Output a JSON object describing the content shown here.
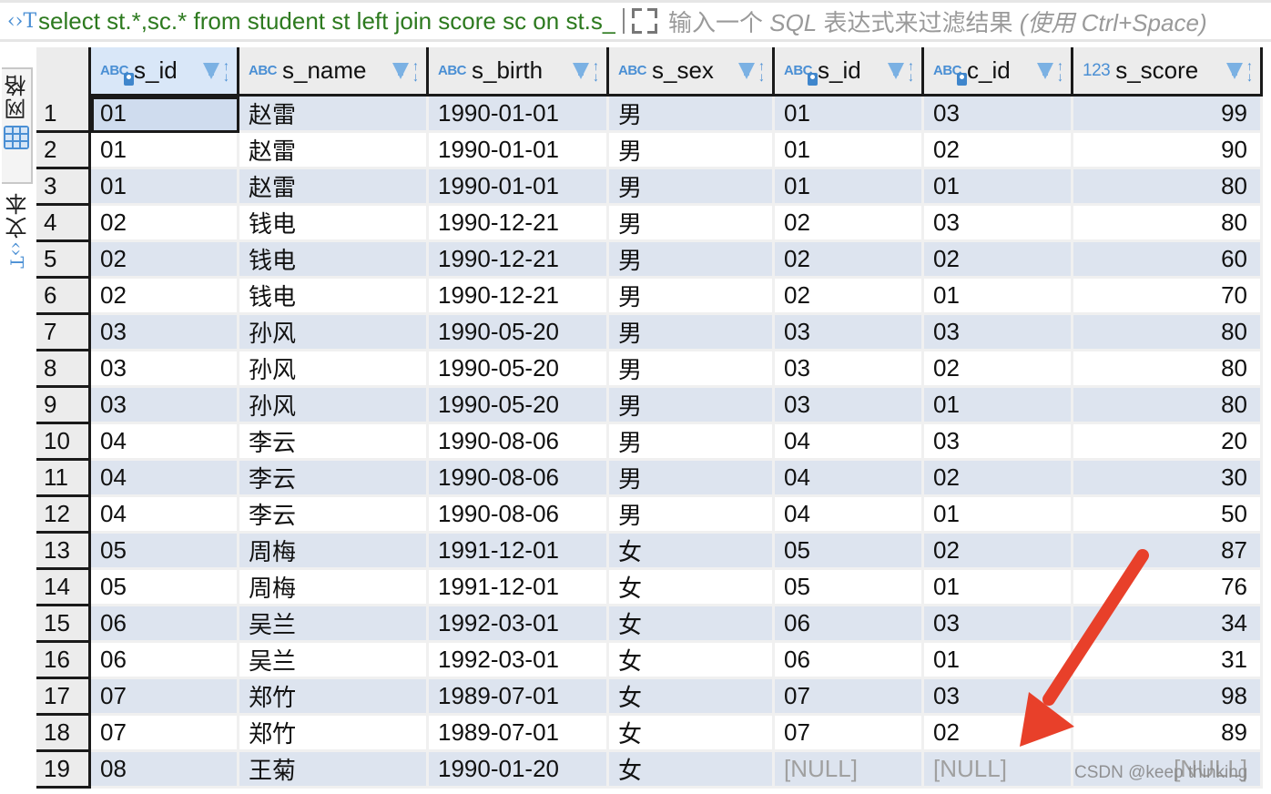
{
  "filter_bar": {
    "sql_icon": "sql-text-icon",
    "query": "select st.*,sc.* from student st left join score sc on st.s_id = sc.s_id",
    "expand_icon": "expand-icon",
    "placeholder_prefix": "输入一个 ",
    "placeholder_sql": "SQL",
    "placeholder_middle": " 表达式来过滤结果 ",
    "placeholder_suffix": "(使用 Ctrl+Space)"
  },
  "side_tabs": [
    {
      "label": "网格",
      "icon": "grid-icon",
      "active": true
    },
    {
      "label": "文本",
      "icon": "text-icon",
      "active": false
    }
  ],
  "columns": [
    {
      "name": "s_id",
      "type": "ABC",
      "key": true,
      "numeric": false
    },
    {
      "name": "s_name",
      "type": "ABC",
      "key": false,
      "numeric": false
    },
    {
      "name": "s_birth",
      "type": "ABC",
      "key": false,
      "numeric": false
    },
    {
      "name": "s_sex",
      "type": "ABC",
      "key": false,
      "numeric": false
    },
    {
      "name": "s_id",
      "type": "ABC",
      "key": true,
      "numeric": false
    },
    {
      "name": "c_id",
      "type": "ABC",
      "key": true,
      "numeric": false
    },
    {
      "name": "s_score",
      "type": "123",
      "key": false,
      "numeric": true
    }
  ],
  "rows": [
    [
      "1",
      "01",
      "赵雷",
      "1990-01-01",
      "男",
      "01",
      "03",
      "99"
    ],
    [
      "2",
      "01",
      "赵雷",
      "1990-01-01",
      "男",
      "01",
      "02",
      "90"
    ],
    [
      "3",
      "01",
      "赵雷",
      "1990-01-01",
      "男",
      "01",
      "01",
      "80"
    ],
    [
      "4",
      "02",
      "钱电",
      "1990-12-21",
      "男",
      "02",
      "03",
      "80"
    ],
    [
      "5",
      "02",
      "钱电",
      "1990-12-21",
      "男",
      "02",
      "02",
      "60"
    ],
    [
      "6",
      "02",
      "钱电",
      "1990-12-21",
      "男",
      "02",
      "01",
      "70"
    ],
    [
      "7",
      "03",
      "孙风",
      "1990-05-20",
      "男",
      "03",
      "03",
      "80"
    ],
    [
      "8",
      "03",
      "孙风",
      "1990-05-20",
      "男",
      "03",
      "02",
      "80"
    ],
    [
      "9",
      "03",
      "孙风",
      "1990-05-20",
      "男",
      "03",
      "01",
      "80"
    ],
    [
      "10",
      "04",
      "李云",
      "1990-08-06",
      "男",
      "04",
      "03",
      "20"
    ],
    [
      "11",
      "04",
      "李云",
      "1990-08-06",
      "男",
      "04",
      "02",
      "30"
    ],
    [
      "12",
      "04",
      "李云",
      "1990-08-06",
      "男",
      "04",
      "01",
      "50"
    ],
    [
      "13",
      "05",
      "周梅",
      "1991-12-01",
      "女",
      "05",
      "02",
      "87"
    ],
    [
      "14",
      "05",
      "周梅",
      "1991-12-01",
      "女",
      "05",
      "01",
      "76"
    ],
    [
      "15",
      "06",
      "吴兰",
      "1992-03-01",
      "女",
      "06",
      "03",
      "34"
    ],
    [
      "16",
      "06",
      "吴兰",
      "1992-03-01",
      "女",
      "06",
      "01",
      "31"
    ],
    [
      "17",
      "07",
      "郑竹",
      "1989-07-01",
      "女",
      "07",
      "03",
      "98"
    ],
    [
      "18",
      "07",
      "郑竹",
      "1989-07-01",
      "女",
      "07",
      "02",
      "89"
    ],
    [
      "19",
      "08",
      "王菊",
      "1990-01-20",
      "女",
      "[NULL]",
      "[NULL]",
      "[NULL]"
    ]
  ],
  "null_text": "[NULL]",
  "annotation": {
    "color": "#e8402a",
    "points_to": "row 19 NULL values"
  },
  "watermark": "CSDN @keep   thinking",
  "colors": {
    "sql_text": "#2d7a1f",
    "accent": "#4a8fd4",
    "row_alt": "#dde4ef",
    "null_text": "#a0a0a0"
  }
}
